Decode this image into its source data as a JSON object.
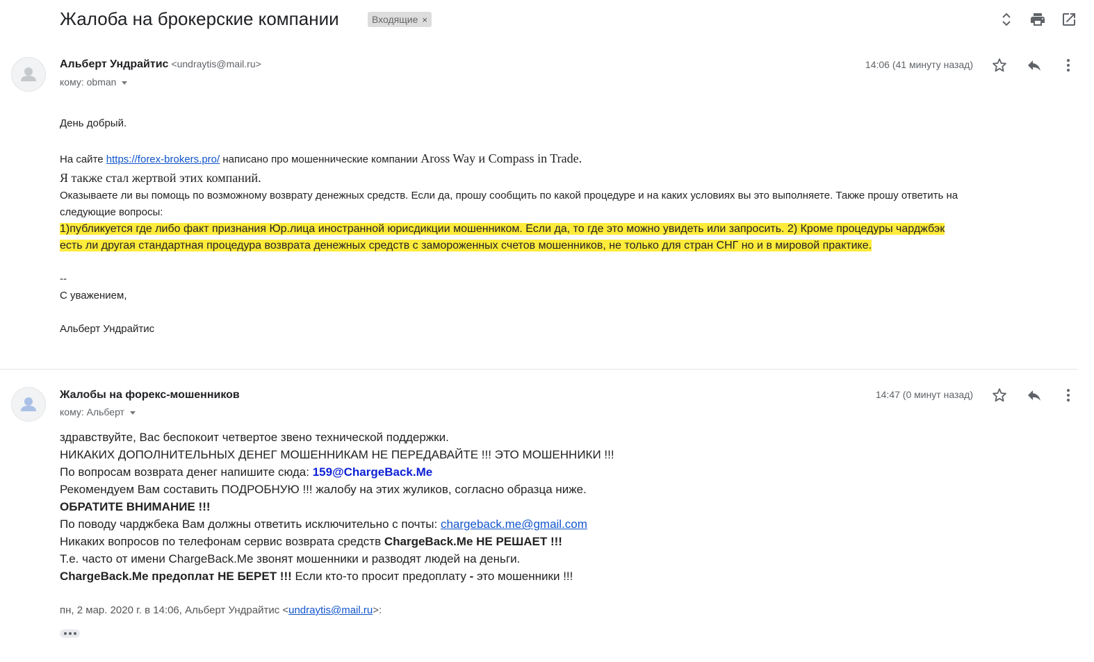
{
  "thread": {
    "subject": "Жалоба на брокерские компании",
    "label": "Входящие",
    "label_remove": "×"
  },
  "icons": {
    "expand": "unfold-icon",
    "print": "print-icon",
    "new_window": "open-in-new-icon",
    "star": "star-icon",
    "reply": "reply-icon",
    "more": "more-vert-icon",
    "avatar": "person-icon"
  },
  "message1": {
    "sender_name": "Альберт Ундрайтис",
    "sender_email": "<undraytis@mail.ru>",
    "to": "кому: obman",
    "time": "14:06 (41 минуту назад)",
    "greeting": "День добрый.",
    "line1_pre": "На сайте ",
    "line1_link": "https://forex-brokers.pro/",
    "line1_post": " написано про мошеннические компании ",
    "line1_companies": "Aross Way и Compass in Trade.",
    "line2": "Я также стал жертвой этих компаний.",
    "line3": "Оказываете ли вы помощь по возможному возврату денежных средств. Если да, прошу сообщить по какой процедуре и на каких условиях вы это выполняете. Также прошу ответить на",
    "line4": "следующие вопросы:",
    "highlight1": "1)публикуется где либо факт признания Юр.лица иностранной юрисдикции мошенником. Если да, то где это можно увидеть или запросить. 2) Кроме процедуры чарджбэк",
    "highlight2": "есть ли другая стандартная процедура возврата денежных средств с замороженных счетов мошенников, не только для стран СНГ но и в мировой практике.",
    "sig_sep": "--",
    "sig_regards": "С уважением,",
    "sig_name": "Альберт Ундрайтис"
  },
  "message2": {
    "sender_name": "Жалобы на форекс-мошенников",
    "to": "кому: Альберт",
    "time": "14:47 (0 минут назад)",
    "l1": "здравствуйте, Вас беспокоит четвертое звено технической поддержки.",
    "l2": "НИКАКИХ ДОПОЛНИТЕЛЬНЫХ ДЕНЕГ МОШЕННИКАМ НЕ ПЕРЕДАВАЙТЕ !!! ЭТО МОШЕННИКИ !!!",
    "l3_pre": "По вопросам возврата денег напишите сюда: ",
    "l3_email": "159@ChargeBack.Me",
    "l4": "Рекомендуем Вам составить ПОДРОБНУЮ !!! жалобу на этих жуликов, согласно образца ниже.",
    "l5": "ОБРАТИТЕ ВНИМАНИЕ !!!",
    "l6_pre": "По поводу чарджбека Вам должны ответить исключительно с почты: ",
    "l6_link": "chargeback.me@gmail.com",
    "l7_pre": "Никаких вопросов по телефонам сервис возврата средств ",
    "l7_bold": "ChargeBack.Me НЕ РЕШАЕТ !!!",
    "l8": "Т.е. часто от имени ChargeBack.Me звонят мошенники и разводят людей на деньги.",
    "l9_bold": "ChargeBack.Me предоплат НЕ БЕРЕТ !!!",
    "l9_mid": " Если кто-то просит предоплату ",
    "l9_dash": "-",
    "l9_post": " это мошенники !!!",
    "quote_pre": "пн, 2 мар. 2020 г. в 14:06, Альберт Ундрайтис <",
    "quote_email": "undraytis@mail.ru",
    "quote_post": ">:"
  }
}
